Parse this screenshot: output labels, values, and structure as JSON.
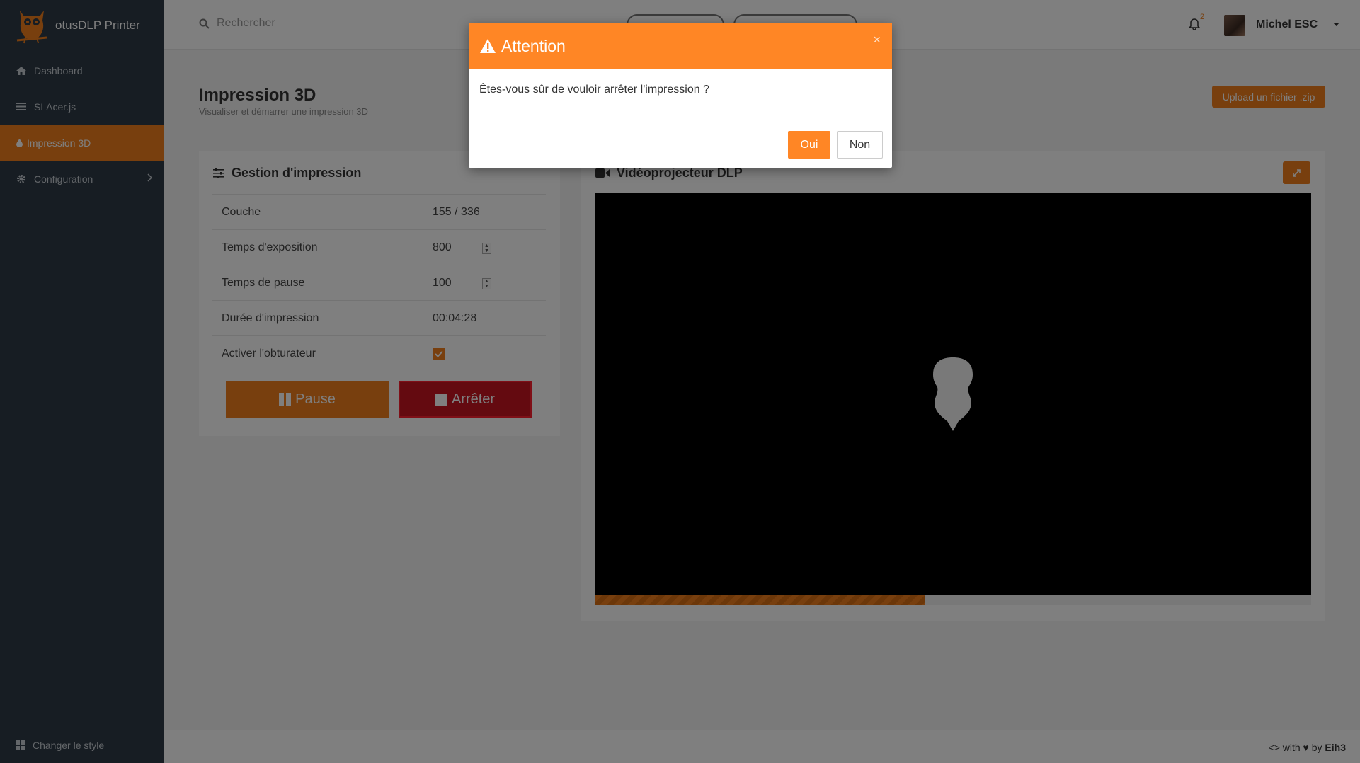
{
  "app": {
    "name": "otusDLP Printer"
  },
  "sidebar": {
    "items": [
      {
        "label": "Dashboard",
        "icon": "home-icon"
      },
      {
        "label": "SLAcer.js",
        "icon": "list-icon"
      },
      {
        "label": "Impression 3D",
        "icon": "drop-icon",
        "active": true
      },
      {
        "label": "Configuration",
        "icon": "gear-icon"
      }
    ],
    "footer_label": "Changer le style"
  },
  "topbar": {
    "search_placeholder": "Rechercher",
    "notification_count": "2",
    "user_name": "Michel ESC"
  },
  "page": {
    "title": "Impression 3D",
    "subtitle": "Visualiser et démarrer une impression 3D",
    "upload_label": "Upload un fichier .zip"
  },
  "gestion": {
    "title": "Gestion d'impression",
    "rows": [
      {
        "label": "Couche",
        "value": "155 / 336"
      },
      {
        "label": "Temps d'exposition",
        "value": "800"
      },
      {
        "label": "Temps de pause",
        "value": "100"
      },
      {
        "label": "Durée d'impression",
        "value": "00:04:28"
      },
      {
        "label": "Activer l'obturateur",
        "checked": true
      }
    ],
    "pause_label": "Pause",
    "stop_label": "Arrêter"
  },
  "video": {
    "title": "Vidéoprojecteur DLP",
    "progress_fraction": 0.461
  },
  "footer": {
    "credit_prefix": "<> with ♥ by",
    "credit_author": "Eih3"
  },
  "modal": {
    "title": "Attention",
    "message": "Êtes-vous sûr de vouloir arrêter l'impression ?",
    "close_symbol": "×",
    "yes_label": "Oui",
    "no_label": "Non"
  },
  "colors": {
    "accent": "#f07f1d",
    "modal_header": "#ff8625",
    "sidebar_bg": "#2e3a46",
    "stop_red": "#c91421"
  }
}
